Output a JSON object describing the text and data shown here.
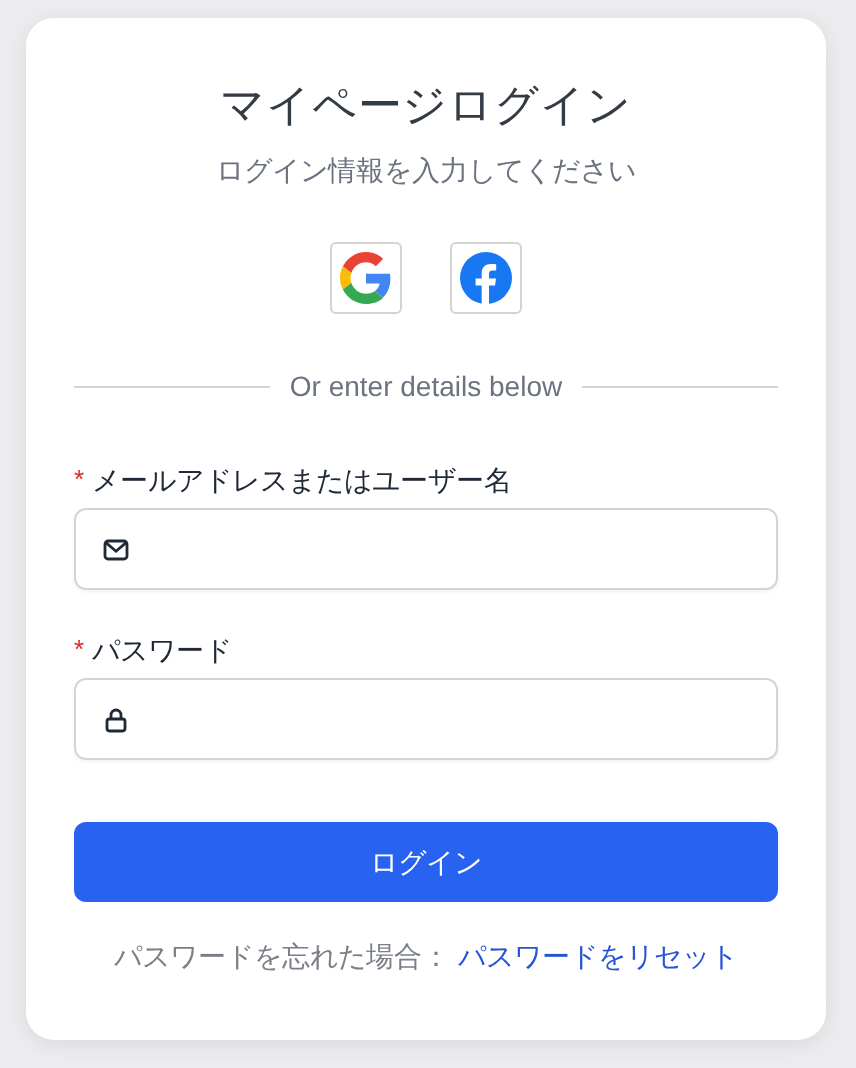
{
  "title": "マイページログイン",
  "subtitle": "ログイン情報を入力してください",
  "social_buttons": [
    {
      "kind": "google"
    },
    {
      "kind": "facebook"
    }
  ],
  "divider_text": "Or enter details below",
  "fields": [
    {
      "kind": "email",
      "marker": "*",
      "label": "メールアドレスまたはユーザー名"
    },
    {
      "kind": "password",
      "marker": "*",
      "label": "パスワード"
    }
  ],
  "submit_button": "ログイン",
  "footer": {
    "text": "パスワードを忘れた場合：",
    "link": "パスワードをリセット"
  }
}
